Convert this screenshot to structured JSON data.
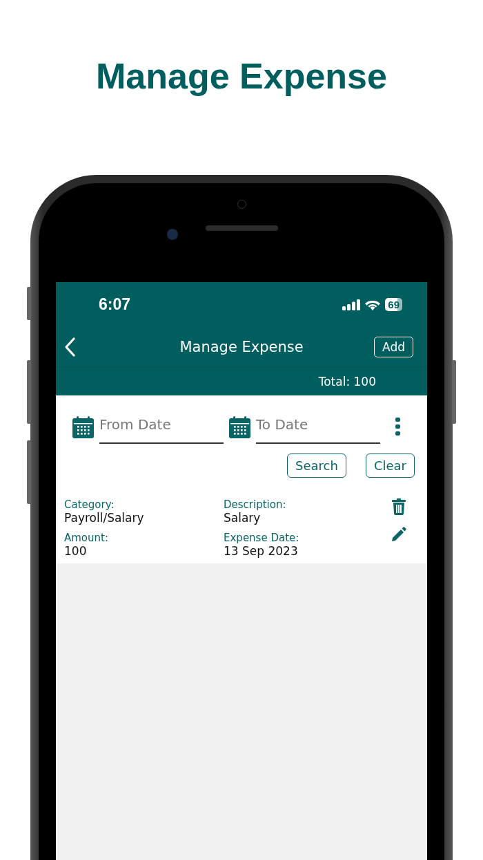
{
  "headline": "Manage Expense",
  "status_bar": {
    "time": "6:07",
    "battery": "69"
  },
  "nav": {
    "title": "Manage Expense",
    "action": "Add"
  },
  "total": "Total: 100",
  "filters": {
    "from": {
      "placeholder": "From Date"
    },
    "to": {
      "placeholder": "To Date"
    },
    "buttons": [
      "Search",
      "Clear"
    ]
  },
  "expenses": [
    {
      "fields": [
        {
          "label": "Category:",
          "value": "Payroll/Salary"
        },
        {
          "label": "Description:",
          "value": "Salary"
        },
        {
          "label": "Amount:",
          "value": "100"
        },
        {
          "label": "Expense Date:",
          "value": "13 Sep 2023"
        }
      ]
    }
  ]
}
